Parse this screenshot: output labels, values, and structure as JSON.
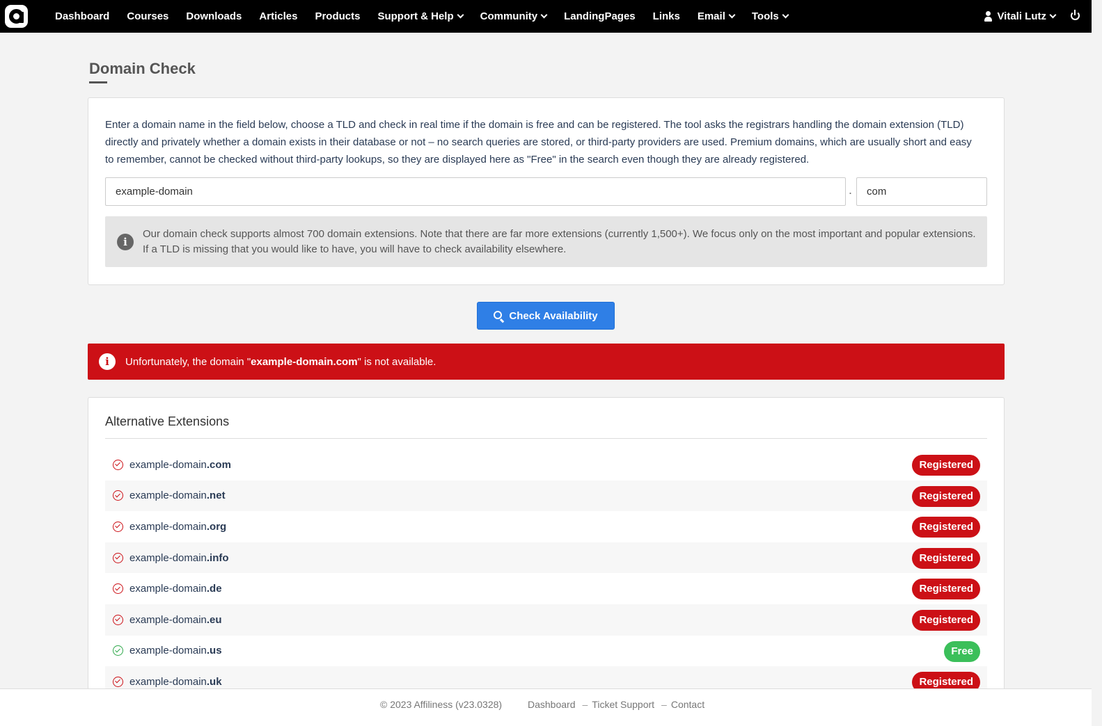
{
  "nav": {
    "items": [
      {
        "label": "Dashboard",
        "dropdown": false
      },
      {
        "label": "Courses",
        "dropdown": false
      },
      {
        "label": "Downloads",
        "dropdown": false
      },
      {
        "label": "Articles",
        "dropdown": false
      },
      {
        "label": "Products",
        "dropdown": false
      },
      {
        "label": "Support & Help",
        "dropdown": true
      },
      {
        "label": "Community",
        "dropdown": true
      },
      {
        "label": "LandingPages",
        "dropdown": false
      },
      {
        "label": "Links",
        "dropdown": false
      },
      {
        "label": "Email",
        "dropdown": true
      },
      {
        "label": "Tools",
        "dropdown": true
      }
    ],
    "user_name": "Vitali Lutz"
  },
  "page": {
    "title": "Domain Check"
  },
  "form": {
    "intro": "Enter a domain name in the field below, choose a TLD and check in real time if the domain is free and can be registered. The tool asks the registrars handling the domain extension (TLD) directly and privately whether a domain exists in their database or not – no search queries are stored, or third-party providers are used. Premium domains, which are usually short and easy to remember, cannot be checked without third-party lookups, so they are displayed here as \"Free\" in the search even though they are already registered.",
    "domain_value": "example-domain",
    "separator": ".",
    "tld_value": "com",
    "info": "Our domain check supports almost 700 domain extensions. Note that there are far more extensions (currently 1,500+). We focus only on the most important and popular extensions. If a TLD is missing that you would like to have, you will have to check availability elsewhere.",
    "check_button": "Check Availability"
  },
  "alert": {
    "prefix": "Unfortunately, the domain \"",
    "domain": "example-domain.com",
    "suffix": "\" is not available."
  },
  "alternatives": {
    "title": "Alternative Extensions",
    "rows": [
      {
        "name": "example-domain",
        "tld": ".com",
        "status": "Registered"
      },
      {
        "name": "example-domain",
        "tld": ".net",
        "status": "Registered"
      },
      {
        "name": "example-domain",
        "tld": ".org",
        "status": "Registered"
      },
      {
        "name": "example-domain",
        "tld": ".info",
        "status": "Registered"
      },
      {
        "name": "example-domain",
        "tld": ".de",
        "status": "Registered"
      },
      {
        "name": "example-domain",
        "tld": ".eu",
        "status": "Registered"
      },
      {
        "name": "example-domain",
        "tld": ".us",
        "status": "Free"
      },
      {
        "name": "example-domain",
        "tld": ".uk",
        "status": "Registered"
      }
    ]
  },
  "footer": {
    "copyright": "© 2023 Affiliness (v23.0328)",
    "links": [
      "Dashboard",
      "Ticket Support",
      "Contact"
    ],
    "separator": "–"
  },
  "colors": {
    "nav_bg": "#000000",
    "primary": "#2f7fe6",
    "danger": "#cc1016",
    "success": "#3bbf5a"
  }
}
